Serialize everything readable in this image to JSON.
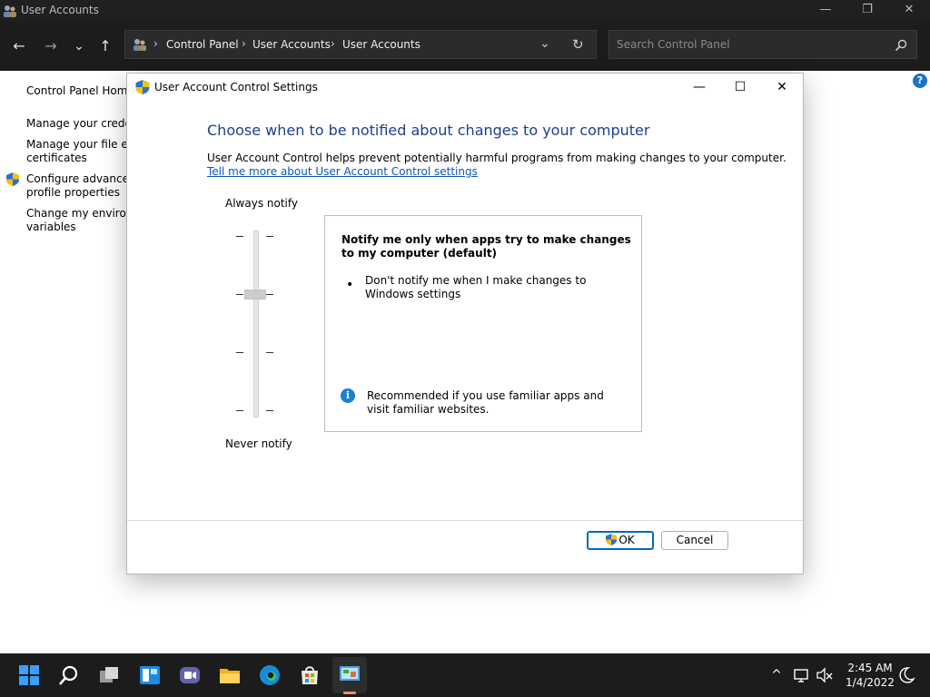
{
  "window": {
    "title": "User Accounts",
    "minimize_glyph": "—",
    "restore_glyph": "❐",
    "close_glyph": "✕"
  },
  "nav": {
    "back_glyph": "←",
    "forward_glyph": "→",
    "recent_glyph": "⌄",
    "up_glyph": "↑",
    "refresh_glyph": "↻",
    "dropdown_glyph": "⌄",
    "separator": "›",
    "breadcrumbs": [
      "Control Panel",
      "User Accounts",
      "User Accounts"
    ],
    "search_placeholder": "Search Control Panel"
  },
  "left_nav": {
    "items": [
      "Control Panel Home",
      "Manage your credentials",
      "Manage your file encryption",
      "certificates",
      "Configure advanced user",
      "profile properties",
      "Change my environment",
      "variables"
    ]
  },
  "help_glyph": "?",
  "dialog": {
    "title": "User Account Control Settings",
    "minimize_glyph": "—",
    "maximize_glyph": "☐",
    "close_glyph": "✕",
    "heading": "Choose when to be notified about changes to your computer",
    "description": "User Account Control helps prevent potentially harmful programs from making changes to your computer.",
    "learn_more_link": "Tell me more about User Account Control settings",
    "slider": {
      "top_label": "Always notify",
      "bottom_label": "Never notify",
      "levels": 4,
      "selected_level": 3
    },
    "info": {
      "title": "Notify me only when apps try to make changes to my computer (default)",
      "bullet_glyph": "•",
      "bullet": "Don't notify me when I make changes to Windows settings",
      "info_glyph": "i",
      "recommendation": "Recommended if you use familiar apps and visit familiar websites."
    },
    "ok_label": "OK",
    "cancel_label": "Cancel"
  },
  "taskbar": {
    "time": "2:45 AM",
    "date": "1/4/2022",
    "apps": [
      "start-icon",
      "search-icon",
      "task-view-icon",
      "widgets-icon",
      "chat-icon",
      "file-explorer-icon",
      "edge-icon",
      "store-icon",
      "control-panel-icon"
    ]
  },
  "colors": {
    "heading": "#1b3f8f",
    "link": "#0b57b8",
    "accent": "#0067c0",
    "titlebar": "#202020",
    "taskbar": "#1c1c1c"
  }
}
